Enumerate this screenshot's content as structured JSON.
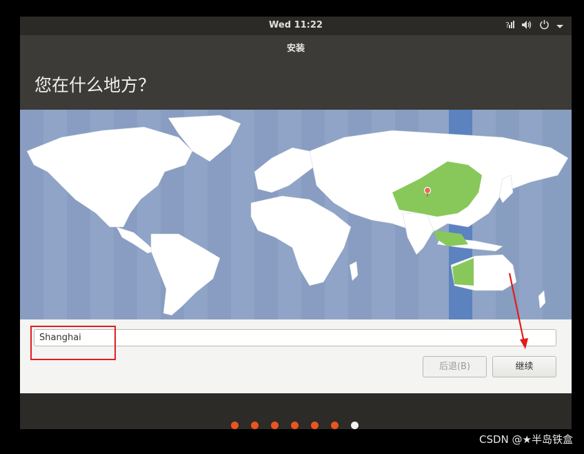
{
  "topbar": {
    "clock": "Wed 11:22"
  },
  "window": {
    "title": "安装"
  },
  "page": {
    "question": "您在什么地方？"
  },
  "location": {
    "value": "Shanghai"
  },
  "buttons": {
    "back_label": "后退(B)",
    "continue_label": "继续"
  },
  "progress": {
    "total_steps": 7,
    "current_step": 7
  },
  "watermark": "CSDN @★半岛铁盒",
  "colors": {
    "accent": "#e95420",
    "map_water": "#8fa4c6",
    "selected_zone": "#88c85a",
    "annotation": "#e21b1b"
  }
}
